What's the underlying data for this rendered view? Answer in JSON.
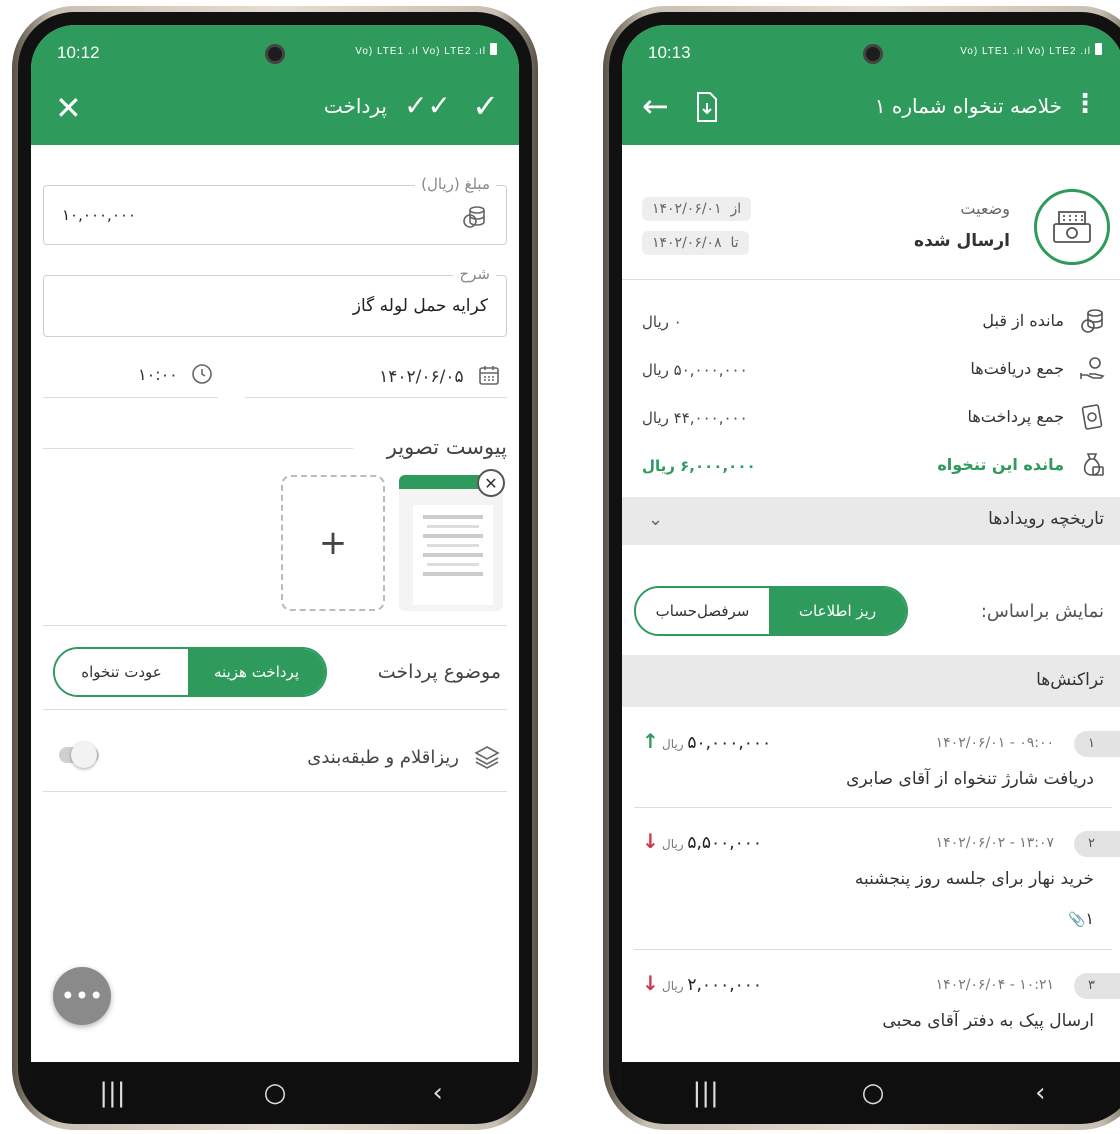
{
  "left": {
    "status_time": "10:12",
    "status_icons": "Vo) LTE1 .ıl Vo) LTE2 .ıl",
    "title": "پرداخت",
    "amount_legend": "مبلغ (ریال)",
    "amount_value": "۱۰,۰۰۰,۰۰۰",
    "desc_legend": "شرح",
    "desc_value": "کرایه حمل لوله گاز",
    "time_value": "۱۰:۰۰",
    "date_value": "۱۴۰۲/۰۶/۰۵",
    "attach_label": "پیوست تصویر",
    "add_label": "+",
    "subject_label": "موضوع پرداخت",
    "subject_options": [
      "پرداخت هزینه",
      "عودت تنخواه"
    ],
    "subject_selected": 0,
    "itemize_label": "ریزاقلام و طبقه‌بندی",
    "itemize_enabled": false,
    "fab_label": "•••"
  },
  "right": {
    "status_time": "10:13",
    "status_icons": "Vo) LTE1 .ıl Vo) LTE2 .ıl",
    "title": "خلاصه تنخواه شماره ۱",
    "status_label": "وضعیت",
    "status_value": "ارسال شده",
    "from_label": "از",
    "from_date": "۱۴۰۲/۰۶/۰۱",
    "to_label": "تا",
    "to_date": "۱۴۰۲/۰۶/۰۸",
    "summary": [
      {
        "label": "مانده از قبل",
        "value": "۰ ریال",
        "icon": "coins-icon",
        "highlight": false
      },
      {
        "label": "جمع دریافت‌ها",
        "value": "۵۰,۰۰۰,۰۰۰ ریال",
        "icon": "receive-icon",
        "highlight": false
      },
      {
        "label": "جمع پرداخت‌ها",
        "value": "۴۴,۰۰۰,۰۰۰ ریال",
        "icon": "payment-icon",
        "highlight": false
      },
      {
        "label": "مانده این تنخواه",
        "value": "۶,۰۰۰,۰۰۰ ریال",
        "icon": "money-bag-icon",
        "highlight": true
      }
    ],
    "history_label": "تاریخچه رویدادها",
    "show_by_label": "نمایش براساس:",
    "show_by_options": [
      "ریز اطلاعات",
      "سرفصل‌حساب"
    ],
    "show_by_selected": 0,
    "transactions_label": "تراکنش‌ها",
    "currency": "ریال",
    "transactions": [
      {
        "index": "۱",
        "datetime": "۱۴۰۲/۰۶/۰۱ - ۰۹:۰۰",
        "amount": "۵۰,۰۰۰,۰۰۰",
        "direction": "in",
        "desc": "دریافت شارژ تنخواه از آقای صابری",
        "attachments": ""
      },
      {
        "index": "۲",
        "datetime": "۱۴۰۲/۰۶/۰۲ - ۱۳:۰۷",
        "amount": "۵,۵۰۰,۰۰۰",
        "direction": "out",
        "desc": "خرید نهار برای جلسه روز پنجشنبه",
        "attachments": "۱"
      },
      {
        "index": "۳",
        "datetime": "۱۴۰۲/۰۶/۰۴ - ۱۰:۲۱",
        "amount": "۲,۰۰۰,۰۰۰",
        "direction": "out",
        "desc": "ارسال پیک به دفتر آقای محبی",
        "attachments": ""
      }
    ]
  },
  "colors": {
    "primary": "#2e9a5c",
    "incoming": "#2e9a5c",
    "outgoing": "#d0364f"
  }
}
